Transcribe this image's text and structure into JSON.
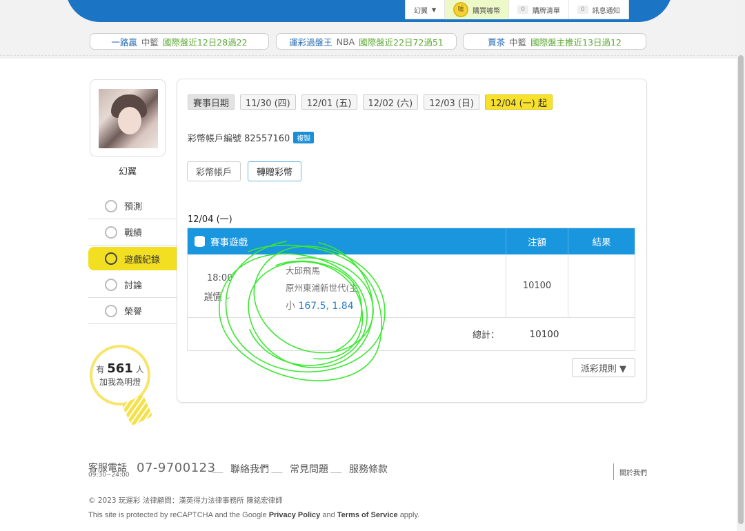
{
  "top_nav": {
    "user": "幻翼",
    "buy_coin": "購買噱幣",
    "coin_badge": "噱",
    "cart_count": "0",
    "cart_label": "購牌清單",
    "notify_count": "0",
    "notify_label": "訊息通知"
  },
  "tickers": [
    {
      "who": "一路贏",
      "league": "中籃",
      "record": "國際盤近12日28過22"
    },
    {
      "who": "運彩過盤王",
      "league": "NBA",
      "record": "國際盤近22日72過51"
    },
    {
      "who": "賈茶",
      "league": "中籃",
      "record": "國際盤主推近13日過12"
    }
  ],
  "profile": {
    "username": "幻翼"
  },
  "menu": [
    {
      "label": "預測",
      "icon": "crosshair-icon"
    },
    {
      "label": "戰績",
      "icon": "chat-icon"
    },
    {
      "label": "遊戲紀錄",
      "icon": "record-icon",
      "active": true
    },
    {
      "label": "討論",
      "icon": "discuss-icon"
    },
    {
      "label": "榮譽",
      "icon": "medal-icon"
    }
  ],
  "followers": {
    "prefix": "有",
    "count": "561",
    "unit": "人",
    "caption": "加我為明燈"
  },
  "dates": {
    "label": "賽事日期",
    "items": [
      "11/30 (四)",
      "12/01 (五)",
      "12/02 (六)",
      "12/03 (日)",
      "12/04 (一) 起"
    ],
    "active_index": 4
  },
  "account": {
    "label": "彩幣帳戶編號 82557160",
    "copy": "複製"
  },
  "tabs": [
    {
      "label": "彩幣帳戶"
    },
    {
      "label": "轉贈彩幣",
      "active": true
    }
  ],
  "day": "12/04 (一)",
  "table": {
    "headers": {
      "game": "賽事遊戲",
      "bet": "注額",
      "result": "結果"
    },
    "rows": [
      {
        "time": "18:00",
        "detail": "詳情",
        "team1": "大邱飛馬",
        "team2": "原州東浦新世代(主",
        "pick_prefix": "小",
        "pick_value": "167.5, 1.84",
        "bet": "10100",
        "result": ""
      }
    ],
    "total_label": "總計：",
    "total": "10100"
  },
  "rules_button": "派彩規則 ▼",
  "footer": {
    "hotline_label": "客服電話",
    "hours": "09:30~24:00",
    "phone": "07-9700123",
    "links": [
      "聯絡我們",
      "常見問題",
      "服務條款"
    ],
    "about": "關於我們",
    "copyright": "© 2023 玩運彩 法律顧問：漢英得力法律事務所 陳銘宏律師",
    "recaptcha_prefix": "This site is protected by reCAPTCHA and the Google",
    "privacy": "Privacy Policy",
    "and": "and",
    "terms": "Terms of Service",
    "apply": "apply."
  },
  "colors": {
    "brand_blue": "#1a96df",
    "accent_yellow": "#f7e12a",
    "scribble_green": "#33ee22"
  }
}
